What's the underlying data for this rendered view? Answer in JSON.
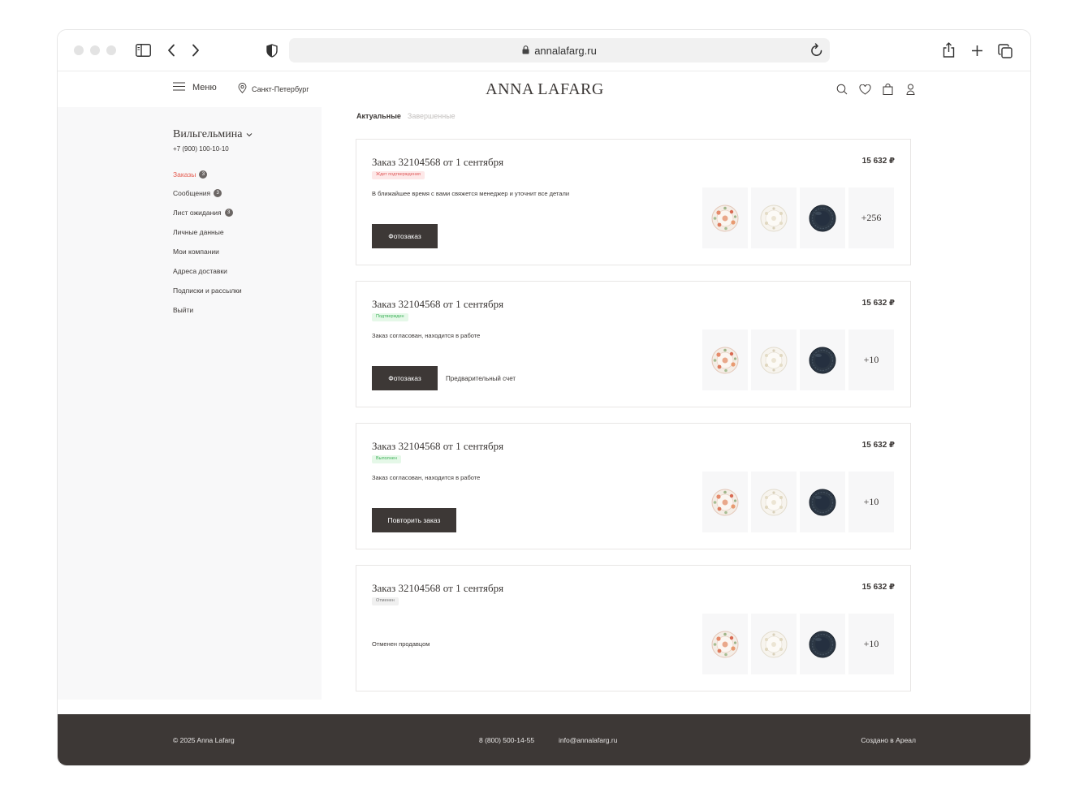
{
  "browser": {
    "url": "annalafarg.ru"
  },
  "header": {
    "menu_label": "Меню",
    "city": "Санкт-Петербург",
    "logo": "ANNA LAFARG"
  },
  "sidebar": {
    "user_name": "Вильгельмина",
    "phone": "+7 (900) 100-10-10",
    "items": [
      {
        "label": "Заказы",
        "badge": "3",
        "active": true
      },
      {
        "label": "Сообщения",
        "badge": "3"
      },
      {
        "label": "Лист ожидания",
        "badge": "3"
      },
      {
        "label": "Личные данные"
      },
      {
        "label": "Мои компании"
      },
      {
        "label": "Адреса доставки"
      },
      {
        "label": "Подписки и рассылки"
      },
      {
        "label": "Выйти"
      }
    ]
  },
  "tabs": [
    {
      "label": "Актуальные",
      "active": true
    },
    {
      "label": "Завершенные",
      "active": false
    }
  ],
  "orders": [
    {
      "title": "Заказ 32104568 от 1 сентября",
      "sum": "15 632 ₽",
      "status": "Ждет подтверждения",
      "description": "В ближайшее время с вами свяжется менеджер и уточнит все детали",
      "button": "Фотозаказ",
      "more_count": "+256"
    },
    {
      "title": "Заказ 32104568 от 1 сентября",
      "sum": "15 632 ₽",
      "status": "Подтвержден",
      "description": "Заказ согласован, находится в работе",
      "button": "Фотозаказ",
      "secondary_link": "Предварительный счет",
      "more_count": "+10"
    },
    {
      "title": "Заказ 32104568 от 1 сентября",
      "sum": "15 632 ₽",
      "status": "Выполнен",
      "description": "Заказ согласован, находится в работе",
      "button": "Повторить заказ",
      "more_count": "+10"
    },
    {
      "title": "Заказ 32104568 от 1 сентября",
      "sum": "15 632 ₽",
      "status": "Отменен",
      "description": "Отменен продавцом",
      "more_count": "+10"
    }
  ],
  "footer": {
    "copyright": "© 2025 Anna Lafarg",
    "phone": "8 (800) 500-14-55",
    "email": "info@annalafarg.ru",
    "credit": "Создано в Ареал"
  },
  "colors": {
    "accent_red": "#e55b4f",
    "dark": "#3d3836",
    "status_await": "#e05a5a",
    "status_ok": "#3fb25a"
  }
}
